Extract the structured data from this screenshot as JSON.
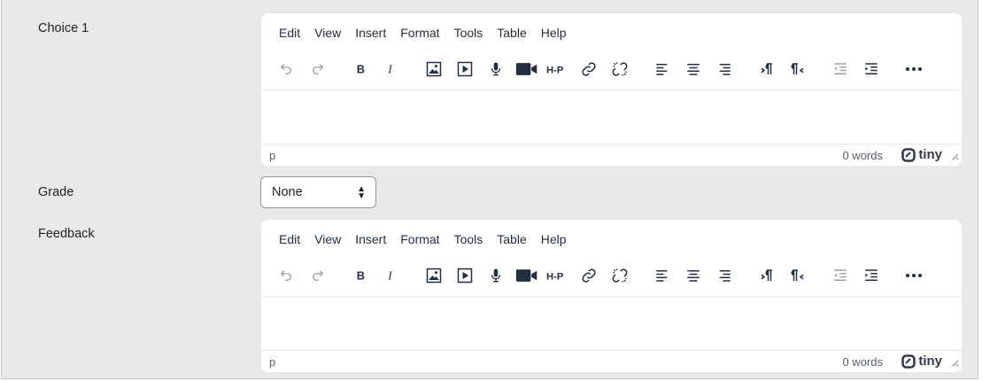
{
  "form": {
    "choice": {
      "label": "Choice 1"
    },
    "grade": {
      "label": "Grade",
      "selected": "None"
    },
    "feedback": {
      "label": "Feedback"
    }
  },
  "editor": {
    "menu": [
      "Edit",
      "View",
      "Insert",
      "Format",
      "Tools",
      "Table",
      "Help"
    ],
    "toolbar_icons": [
      "undo-icon",
      "redo-icon",
      "bold-icon",
      "italic-icon",
      "image-icon",
      "media-icon",
      "record-audio-icon",
      "record-video-icon",
      "h5p-icon",
      "link-icon",
      "unlink-icon",
      "align-left-icon",
      "align-center-icon",
      "align-right-icon",
      "ltr-icon",
      "rtl-icon",
      "outdent-icon",
      "indent-icon",
      "more-icon"
    ],
    "status_path": "p",
    "word_count": "0 words",
    "brand": "tiny"
  },
  "colors": {
    "panel_bg": "#e9e9e9",
    "editor_bg": "#ffffff",
    "text": "#1d2125",
    "icon": "#222f3e",
    "icon_disabled": "#9aa0a6"
  }
}
